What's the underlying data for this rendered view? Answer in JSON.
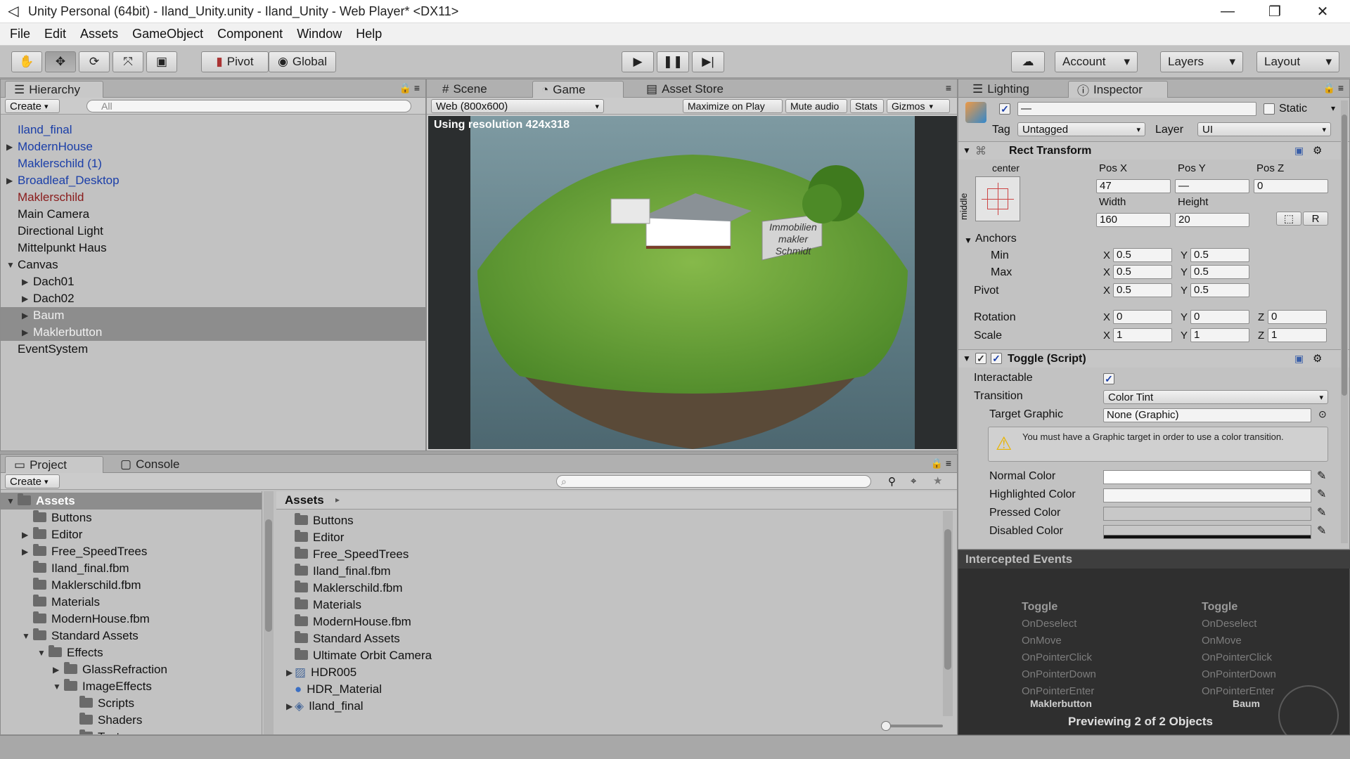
{
  "window": {
    "title": "Unity Personal (64bit) - Iland_Unity.unity - Iland_Unity - Web Player* <DX11>",
    "minimize": "—",
    "restore": "❐",
    "close": "✕"
  },
  "menu": [
    "File",
    "Edit",
    "Assets",
    "GameObject",
    "Component",
    "Window",
    "Help"
  ],
  "toolbar": {
    "pivot": "Pivot",
    "global": "Global",
    "account": "Account",
    "layers": "Layers",
    "layout": "Layout"
  },
  "hierarchy": {
    "tab": "Hierarchy",
    "create": "Create",
    "search_placeholder": "All",
    "items": [
      {
        "label": "Iland_final",
        "color": "blue",
        "indent": 0,
        "arrow": "",
        "selected": false
      },
      {
        "label": "ModernHouse",
        "color": "blue",
        "indent": 0,
        "arrow": "right",
        "selected": false
      },
      {
        "label": "Maklerschild (1)",
        "color": "blue",
        "indent": 0,
        "arrow": "",
        "selected": false
      },
      {
        "label": "Broadleaf_Desktop",
        "color": "blue",
        "indent": 0,
        "arrow": "right",
        "selected": false
      },
      {
        "label": "Maklerschild",
        "color": "red",
        "indent": 0,
        "arrow": "",
        "selected": false
      },
      {
        "label": "Main Camera",
        "color": "black",
        "indent": 0,
        "arrow": "",
        "selected": false
      },
      {
        "label": "Directional Light",
        "color": "black",
        "indent": 0,
        "arrow": "",
        "selected": false
      },
      {
        "label": "Mittelpunkt Haus",
        "color": "black",
        "indent": 0,
        "arrow": "",
        "selected": false
      },
      {
        "label": "Canvas",
        "color": "black",
        "indent": 0,
        "arrow": "down",
        "selected": false
      },
      {
        "label": "Dach01",
        "color": "black",
        "indent": 1,
        "arrow": "right",
        "selected": false
      },
      {
        "label": "Dach02",
        "color": "black",
        "indent": 1,
        "arrow": "right",
        "selected": false
      },
      {
        "label": "Baum",
        "color": "black",
        "indent": 1,
        "arrow": "right",
        "selected": true
      },
      {
        "label": "Maklerbutton",
        "color": "black",
        "indent": 1,
        "arrow": "right",
        "selected": true
      },
      {
        "label": "EventSystem",
        "color": "black",
        "indent": 0,
        "arrow": "",
        "selected": false
      }
    ]
  },
  "center": {
    "tabs": [
      "Scene",
      "Game",
      "Asset Store"
    ],
    "resolution": "Web (800x600)",
    "maximize": "Maximize on Play",
    "mute": "Mute audio",
    "stats": "Stats",
    "gizmos": "Gizmos",
    "overlay": "Using resolution 424x318",
    "sign": "Immobilien makler Schmidt"
  },
  "inspector": {
    "tabs": [
      "Lighting",
      "Inspector"
    ],
    "name_value": "—",
    "static": "Static",
    "tag_label": "Tag",
    "tag_value": "Untagged",
    "layer_label": "Layer",
    "layer_value": "UI",
    "rect_title": "Rect Transform",
    "anchor_h": "center",
    "anchor_v": "middle",
    "posx_label": "Pos X",
    "posy_label": "Pos Y",
    "posz_label": "Pos Z",
    "posx": "47",
    "posy": "—",
    "posz": "0",
    "width_label": "Width",
    "height_label": "Height",
    "width": "160",
    "height": "20",
    "r_btn": "R",
    "anchors": "Anchors",
    "min": "Min",
    "max": "Max",
    "pivot": "Pivot",
    "x": "X",
    "y": "Y",
    "z": "Z",
    "min_x": "0.5",
    "min_y": "0.5",
    "max_x": "0.5",
    "max_y": "0.5",
    "pivot_x": "0.5",
    "pivot_y": "0.5",
    "rotation": "Rotation",
    "rot_x": "0",
    "rot_y": "0",
    "rot_z": "0",
    "scale": "Scale",
    "scale_x": "1",
    "scale_y": "1",
    "scale_z": "1",
    "toggle_title": "Toggle (Script)",
    "interactable": "Interactable",
    "transition": "Transition",
    "transition_value": "Color Tint",
    "target_graphic": "Target Graphic",
    "target_graphic_value": "None (Graphic)",
    "warning": "You must have a Graphic target in order to use a color transition.",
    "normal": "Normal Color",
    "highlighted": "Highlighted Color",
    "pressed": "Pressed Color",
    "disabled": "Disabled Color"
  },
  "events": {
    "title": "Intercepted Events",
    "col_title": "Toggle",
    "items": [
      "OnDeselect",
      "OnMove",
      "OnPointerClick",
      "OnPointerDown",
      "OnPointerEnter"
    ],
    "obj1": "Maklerbutton",
    "obj2": "Baum",
    "preview": "Previewing 2 of 2 Objects"
  },
  "project": {
    "tabs": [
      "Project",
      "Console"
    ],
    "create": "Create",
    "tree": [
      {
        "label": "Assets",
        "indent": 0,
        "arrow": "down",
        "selected": true
      },
      {
        "label": "Buttons",
        "indent": 1,
        "arrow": "",
        "selected": false
      },
      {
        "label": "Editor",
        "indent": 1,
        "arrow": "right",
        "selected": false
      },
      {
        "label": "Free_SpeedTrees",
        "indent": 1,
        "arrow": "right",
        "selected": false
      },
      {
        "label": "Iland_final.fbm",
        "indent": 1,
        "arrow": "",
        "selected": false
      },
      {
        "label": "Maklerschild.fbm",
        "indent": 1,
        "arrow": "",
        "selected": false
      },
      {
        "label": "Materials",
        "indent": 1,
        "arrow": "",
        "selected": false
      },
      {
        "label": "ModernHouse.fbm",
        "indent": 1,
        "arrow": "",
        "selected": false
      },
      {
        "label": "Standard Assets",
        "indent": 1,
        "arrow": "down",
        "selected": false
      },
      {
        "label": "Effects",
        "indent": 2,
        "arrow": "down",
        "selected": false
      },
      {
        "label": "GlassRefraction",
        "indent": 3,
        "arrow": "right",
        "selected": false
      },
      {
        "label": "ImageEffects",
        "indent": 3,
        "arrow": "down",
        "selected": false
      },
      {
        "label": "Scripts",
        "indent": 4,
        "arrow": "",
        "selected": false
      },
      {
        "label": "Shaders",
        "indent": 4,
        "arrow": "",
        "selected": false
      },
      {
        "label": "Textures",
        "indent": 4,
        "arrow": "",
        "selected": false
      }
    ],
    "breadcrumb": "Assets",
    "files": [
      {
        "label": "Buttons",
        "type": "folder",
        "arrow": ""
      },
      {
        "label": "Editor",
        "type": "folder",
        "arrow": ""
      },
      {
        "label": "Free_SpeedTrees",
        "type": "folder",
        "arrow": ""
      },
      {
        "label": "Iland_final.fbm",
        "type": "folder",
        "arrow": ""
      },
      {
        "label": "Maklerschild.fbm",
        "type": "folder",
        "arrow": ""
      },
      {
        "label": "Materials",
        "type": "folder",
        "arrow": ""
      },
      {
        "label": "ModernHouse.fbm",
        "type": "folder",
        "arrow": ""
      },
      {
        "label": "Standard Assets",
        "type": "folder",
        "arrow": ""
      },
      {
        "label": "Ultimate Orbit Camera",
        "type": "folder",
        "arrow": ""
      },
      {
        "label": "HDR005",
        "type": "texture",
        "arrow": "right"
      },
      {
        "label": "HDR_Material",
        "type": "material",
        "arrow": ""
      },
      {
        "label": "Iland_final",
        "type": "model",
        "arrow": "right"
      }
    ]
  }
}
